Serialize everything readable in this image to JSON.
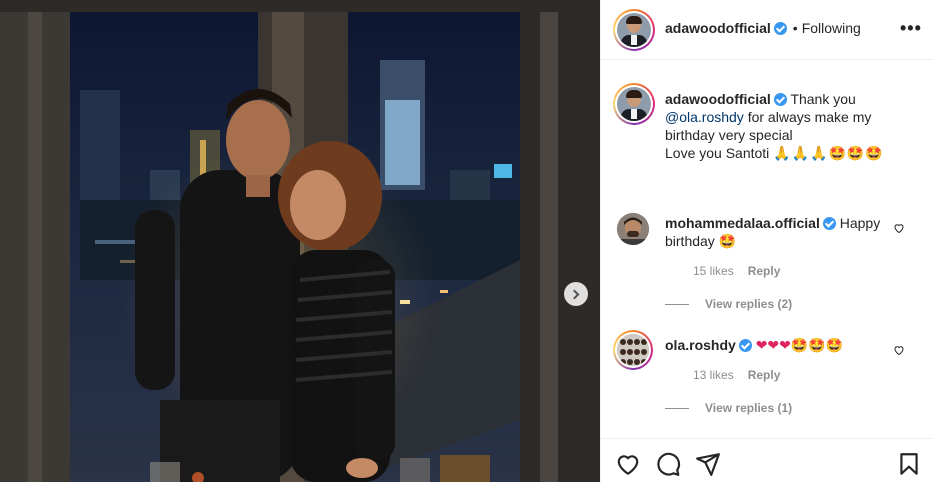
{
  "post": {
    "username": "adawoodofficial",
    "follow_state": "Following",
    "more_label": "•••",
    "dot_separator": "•"
  },
  "caption": {
    "username": "adawoodofficial",
    "text_before": "Thank you",
    "mention": "@ola.roshdy",
    "text_line2": "for always make my",
    "text_line3": "birthday very special",
    "text_line4": "Love you Santoti",
    "emojis": "🙏🙏🙏🤩🤩🤩"
  },
  "comments": [
    {
      "username": "mohammedalaa.official",
      "text": "Happy birthday",
      "emoji": "🤩",
      "likes": "15 likes",
      "reply_label": "Reply",
      "view_replies": "View replies (2)"
    },
    {
      "username": "ola.roshdy",
      "text": "",
      "emoji": "❤❤❤🤩🤩🤩",
      "likes": "13 likes",
      "reply_label": "Reply",
      "view_replies": "View replies (1)"
    }
  ],
  "icons": {
    "like": "heart-icon",
    "comment": "comment-icon",
    "share": "share-icon",
    "save": "bookmark-icon",
    "next": "chevron-right-icon"
  },
  "colors": {
    "verified": "#3897f0",
    "mention": "#00376b",
    "meta": "#8e8e8e"
  }
}
